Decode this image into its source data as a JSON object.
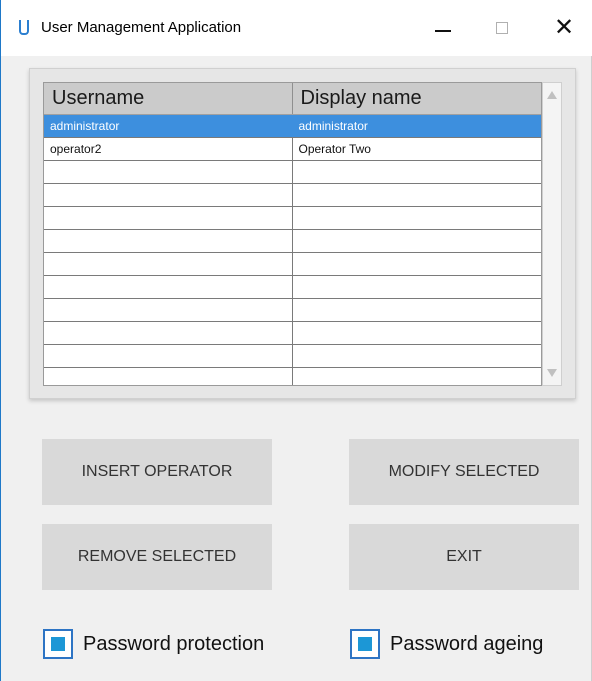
{
  "window": {
    "title": "User Management Application",
    "controls": {
      "minimize": "—",
      "maximize": "☐",
      "close": "✕"
    }
  },
  "table": {
    "columns": [
      "Username",
      "Display name"
    ],
    "rows": [
      {
        "username": "administrator",
        "display_name": "administrator",
        "selected": true
      },
      {
        "username": "operator2",
        "display_name": "Operator Two",
        "selected": false
      }
    ],
    "empty_row_count": 10
  },
  "buttons": {
    "insert": "INSERT OPERATOR",
    "modify": "MODIFY SELECTED",
    "remove": "REMOVE SELECTED",
    "exit": "EXIT"
  },
  "options": {
    "password_protection": {
      "label": "Password protection",
      "checked": true
    },
    "password_ageing": {
      "label": "Password ageing",
      "checked": true
    }
  },
  "colors": {
    "selection": "#3d8fde",
    "checkbox_fill": "#1c97d6",
    "button_bg": "#d9d9d9"
  }
}
